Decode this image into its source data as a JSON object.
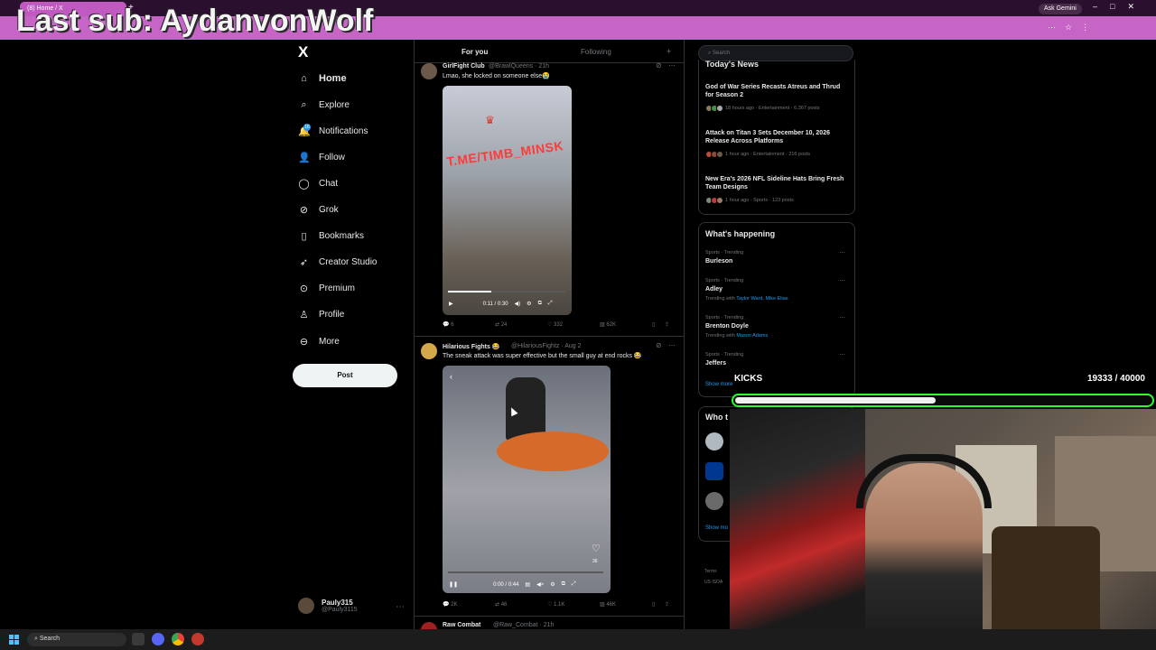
{
  "browser": {
    "tab_title": "(8) Home / X",
    "new_tab_symbol": "+",
    "ask_gemini_label": "Ask Gemini",
    "window_controls": [
      "–",
      "□",
      "✕"
    ],
    "toolbar_icons": [
      "⋯",
      "☆",
      "⋮"
    ]
  },
  "overlay": {
    "last_sub": "Last sub: AydanvonWolf"
  },
  "nav": {
    "logo": "X",
    "items": [
      {
        "label": "Home",
        "icon": "home-icon",
        "glyph": "⌂"
      },
      {
        "label": "Explore",
        "icon": "search-icon",
        "glyph": "⌕"
      },
      {
        "label": "Notifications",
        "icon": "bell-icon",
        "glyph": "🔔"
      },
      {
        "label": "Follow",
        "icon": "person-add-icon",
        "glyph": "👤"
      },
      {
        "label": "Chat",
        "icon": "chat-icon",
        "glyph": "◯"
      },
      {
        "label": "Grok",
        "icon": "grok-icon",
        "glyph": "⊘"
      },
      {
        "label": "Bookmarks",
        "icon": "bookmark-icon",
        "glyph": "▯"
      },
      {
        "label": "Creator Studio",
        "icon": "rocket-icon",
        "glyph": "➶"
      },
      {
        "label": "Premium",
        "icon": "premium-icon",
        "glyph": "⊙"
      },
      {
        "label": "Profile",
        "icon": "profile-icon",
        "glyph": "♙"
      },
      {
        "label": "More",
        "icon": "more-icon",
        "glyph": "⊖"
      }
    ],
    "notifications_badge": "16",
    "post_button": "Post",
    "profile": {
      "name": "Pauly315",
      "handle": "@Pauly3115",
      "more": "⋯"
    }
  },
  "feed": {
    "tabs": {
      "for_you": "For you",
      "following": "Following",
      "plus": "+"
    },
    "tweets": [
      {
        "name": "GirlFight Club",
        "handle": "@BrawlQueens · 21h",
        "text": "Lmao, she locked on someone else😭",
        "watermark": "T.ME/TIMB_MINSK",
        "video_time": "0:11 / 0:30",
        "video_progress": 0.37,
        "actions": {
          "reply": "6",
          "repost": "24",
          "like": "332",
          "views": "62K"
        }
      },
      {
        "name": "Hilarious Fights 😂",
        "handle": "@HilariousFightz · Aug 2",
        "text": "The sneak attack was super effective but the small guy at end rocks 😂",
        "video_time": "0:00 / 0:44",
        "video_progress": 0.0,
        "heart_count": "36",
        "actions": {
          "reply": "2K",
          "repost": "46",
          "like": "1.1K",
          "views": "46K"
        }
      },
      {
        "name": "Raw Combat",
        "handle": "@Raw_Combat · 21h"
      }
    ]
  },
  "sidebar": {
    "search_placeholder": "Search",
    "todays_news": {
      "title": "Today's News",
      "items": [
        {
          "title": "God of War Series Recasts Atreus and Thrud for Season 2",
          "meta": "18 hours ago · Entertainment · 6,367 posts"
        },
        {
          "title": "Attack on Titan 3 Sets December 10, 2026 Release Across Platforms",
          "meta": "1 hour ago · Entertainment · 216 posts"
        },
        {
          "title": "New Era's 2026 NFL Sideline Hats Bring Fresh Team Designs",
          "meta": "1 hour ago · Sports · 123 posts"
        }
      ]
    },
    "whats_happening": {
      "title": "What's happening",
      "items": [
        {
          "category": "Sports · Trending",
          "name": "Burleson",
          "with_prefix": "",
          "with": ""
        },
        {
          "category": "Sports · Trending",
          "name": "Adley",
          "with_prefix": "Trending with",
          "with": "Taylor Ward, Mike Elias"
        },
        {
          "category": "Sports · Trending",
          "name": "Brenton Doyle",
          "with_prefix": "Trending with",
          "with": "Mason Adams"
        },
        {
          "category": "Sports · Trending",
          "name": "Jeffers",
          "with_prefix": "",
          "with": ""
        }
      ],
      "show_more": "Show more",
      "more_symbol": "⋯"
    },
    "who_to_follow": {
      "title": "Who t",
      "show_more": "Show mo"
    },
    "footer": [
      "Terms",
      "US ISOA"
    ]
  },
  "stream": {
    "kicks_label": "KICKS",
    "kicks_count": "19333 / 40000",
    "kicks_progress": 0.483
  },
  "taskbar": {
    "search_label": "Search"
  },
  "colors": {
    "accent": "#1d9bf0",
    "chrome": "#d06bd0",
    "kicks_border": "#2aff2a"
  }
}
